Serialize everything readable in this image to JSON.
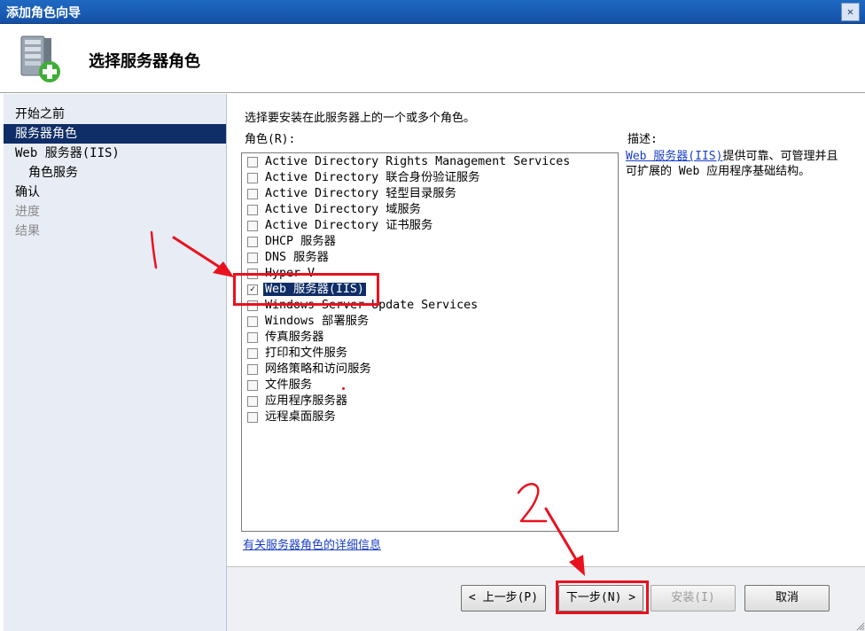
{
  "window": {
    "title": "添加角色向导",
    "close_glyph": "✕"
  },
  "header": {
    "heading": "选择服务器角色",
    "icon": "server-add-icon"
  },
  "sidebar": {
    "items": [
      {
        "label": "开始之前",
        "state": "normal"
      },
      {
        "label": "服务器角色",
        "state": "selected"
      },
      {
        "label": "Web 服务器(IIS)",
        "state": "normal"
      },
      {
        "label": "角色服务",
        "state": "sub"
      },
      {
        "label": "确认",
        "state": "normal"
      },
      {
        "label": "进度",
        "state": "disabled"
      },
      {
        "label": "结果",
        "state": "disabled"
      }
    ]
  },
  "main": {
    "instruction": "选择要安装在此服务器上的一个或多个角色。",
    "roles_label": "角色(R):",
    "roles": [
      {
        "label": "Active Directory Rights Management Services",
        "checked": false
      },
      {
        "label": "Active Directory 联合身份验证服务",
        "checked": false
      },
      {
        "label": "Active Directory 轻型目录服务",
        "checked": false
      },
      {
        "label": "Active Directory 域服务",
        "checked": false
      },
      {
        "label": "Active Directory 证书服务",
        "checked": false
      },
      {
        "label": "DHCP 服务器",
        "checked": false
      },
      {
        "label": "DNS 服务器",
        "checked": false
      },
      {
        "label": "Hyper-V",
        "checked": false
      },
      {
        "label": "Web 服务器(IIS)",
        "checked": true,
        "selected": true
      },
      {
        "label": "Windows Server Update Services",
        "checked": false
      },
      {
        "label": "Windows 部署服务",
        "checked": false
      },
      {
        "label": "传真服务器",
        "checked": false
      },
      {
        "label": "打印和文件服务",
        "checked": false
      },
      {
        "label": "网络策略和访问服务",
        "checked": false
      },
      {
        "label": "文件服务",
        "checked": false
      },
      {
        "label": "应用程序服务器",
        "checked": false
      },
      {
        "label": "远程桌面服务",
        "checked": false
      }
    ],
    "description_title": "描述:",
    "description_link": "Web 服务器(IIS)",
    "description_text": "提供可靠、可管理并且可扩展的 Web 应用程序基础结构。",
    "more_info_link": "有关服务器角色的详细信息"
  },
  "footer": {
    "back": "< 上一步(P)",
    "next": "下一步(N) >",
    "install": "安装(I)",
    "cancel": "取消"
  },
  "annotations": {
    "mark1": "1",
    "mark2": "2",
    "color": "#e8121e"
  }
}
